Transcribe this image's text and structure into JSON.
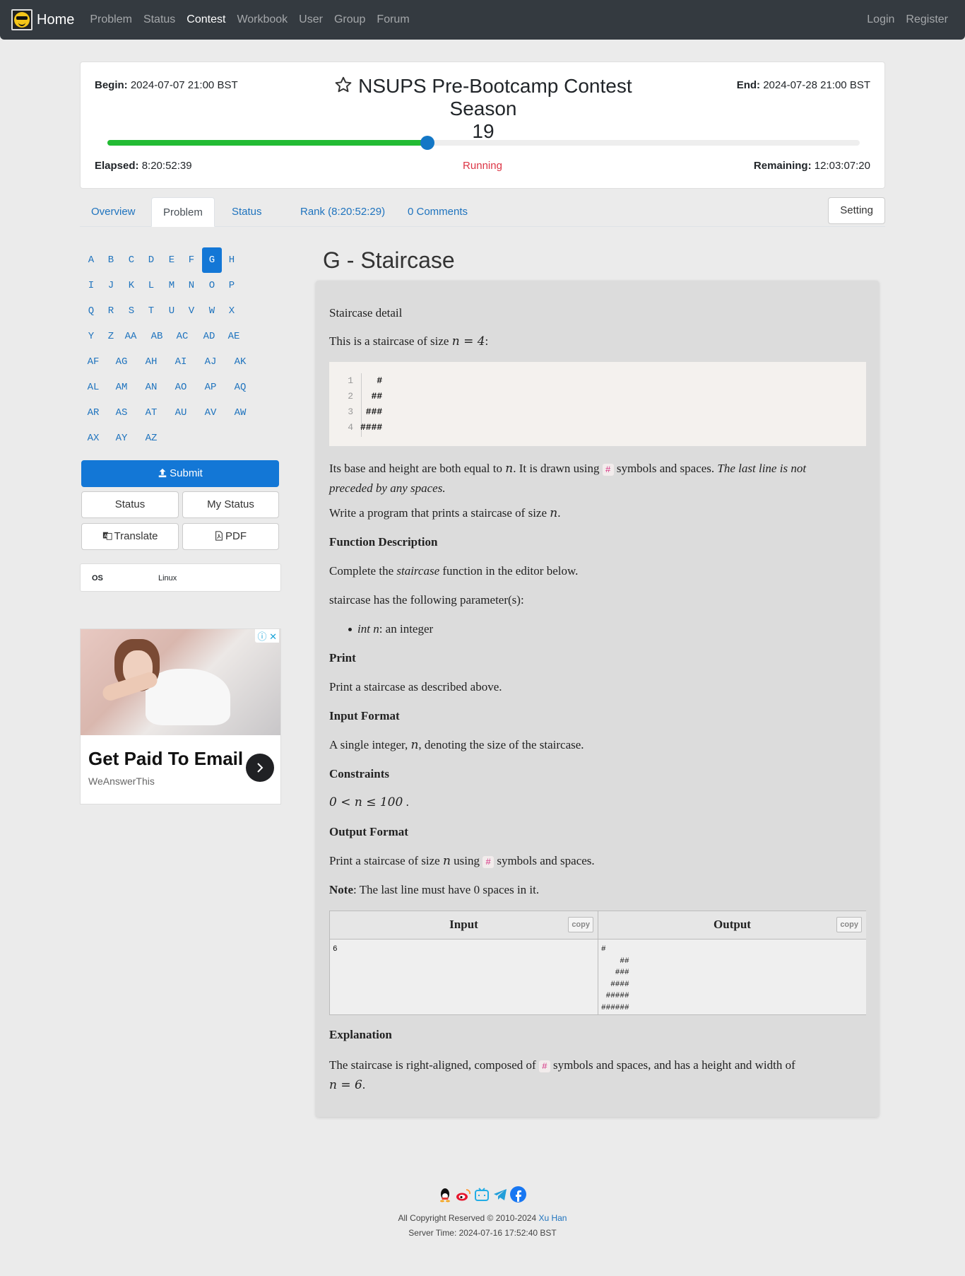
{
  "navbar": {
    "brand": "Home",
    "links": [
      "Problem",
      "Status",
      "Contest",
      "Workbook",
      "User",
      "Group",
      "Forum"
    ],
    "active": "Contest",
    "login": "Login",
    "register": "Register"
  },
  "contest": {
    "begin_label": "Begin:",
    "begin": "2024-07-07 21:00 BST",
    "end_label": "End:",
    "end": "2024-07-28 21:00 BST",
    "title_line1": "NSUPS Pre-Bootcamp Contest Season",
    "title_line2": "19",
    "progress": 0.425,
    "elapsed_label": "Elapsed:",
    "elapsed": "8:20:52:39",
    "status": "Running",
    "remaining_label": "Remaining:",
    "remaining": "12:03:07:20",
    "colors": {
      "progress": "#22bb33",
      "handle": "#1377c6",
      "status": "#dc3545"
    }
  },
  "tabs": {
    "overview": "Overview",
    "problem": "Problem",
    "status": "Status",
    "rank": "Rank (8:20:52:29)",
    "comments": "0 Comments",
    "setting": "Setting"
  },
  "letters": [
    "A",
    "B",
    "C",
    "D",
    "E",
    "F",
    "G",
    "H",
    "I",
    "J",
    "K",
    "L",
    "M",
    "N",
    "O",
    "P",
    "Q",
    "R",
    "S",
    "T",
    "U",
    "V",
    "W",
    "X",
    "Y",
    "Z",
    "AA",
    "AB",
    "AC",
    "AD",
    "AE",
    "AF",
    "AG",
    "AH",
    "AI",
    "AJ",
    "AK",
    "AL",
    "AM",
    "AN",
    "AO",
    "AP",
    "AQ",
    "AR",
    "AS",
    "AT",
    "AU",
    "AV",
    "AW",
    "AX",
    "AY",
    "AZ"
  ],
  "active_letter": "G",
  "actions": {
    "submit": "Submit",
    "status": "Status",
    "my_status": "My Status",
    "translate": "Translate",
    "pdf": "PDF"
  },
  "os": {
    "label": "OS",
    "value": "Linux"
  },
  "ad": {
    "title": "Get Paid To Email",
    "sub": "WeAnswerThis",
    "info": "ⓘ ✕"
  },
  "problem": {
    "title": "G - Staircase",
    "detail": "Staircase detail",
    "intro_a": "This is a staircase of size ",
    "intro_math": "n = 4",
    "intro_b": ":",
    "code_nums": [
      "1",
      "2",
      "3",
      "4"
    ],
    "code_lines": [
      "   #",
      "  ##",
      " ###",
      "####"
    ],
    "p1_a": "Its base and height are both equal to ",
    "p1_math": "n",
    "p1_b": ". It is drawn using ",
    "hash": "#",
    "p1_c": " symbols and spaces. ",
    "p1_italic1": "The last line is not",
    "p1_italic2": "preceded by any spaces.",
    "p2_a": "Write a program that prints a staircase of size ",
    "p2_math": "n",
    "p2_b": ".",
    "h_function": "Function Description",
    "p3_a": "Complete the ",
    "p3_italic": "staircase",
    "p3_b": " function in the editor below.",
    "p4": "staircase has the following parameter(s):",
    "li_italic": "int n",
    "li_rest": ": an integer",
    "h_print": "Print",
    "p5": "Print a staircase as described above.",
    "h_input": "Input Format",
    "p6_a": "A single integer, ",
    "p6_math": "n",
    "p6_b": ", denoting the size of the staircase.",
    "h_constraints": "Constraints",
    "constraint": "0 < n ≤ 100",
    "constraint_end": " .",
    "h_output": "Output Format",
    "p7_a": "Print a staircase of size ",
    "p7_math": "n",
    "p7_b": " using ",
    "p7_c": " symbols and spaces.",
    "note_label": "Note",
    "note_a": ": The last line must have ",
    "note_math": "0",
    "note_b": " spaces in it.",
    "io": {
      "input_label": "Input",
      "output_label": "Output",
      "copy": "copy",
      "input": "6",
      "output": "#\n    ##\n   ###\n  ####\n #####\n######"
    },
    "h_explanation": "Explanation",
    "p8_a": "The staircase is right-aligned, composed of ",
    "p8_b": " symbols and spaces, and has a height and width of",
    "p8_math": "n = 6",
    "p8_c": "."
  },
  "footer": {
    "icons": [
      "qq-icon",
      "weibo-icon",
      "bilibili-icon",
      "telegram-icon",
      "facebook-icon"
    ],
    "copyright": "All Copyright Reserved © 2010-2024 ",
    "author": "Xu Han",
    "server_time": "Server Time: 2024-07-16 17:52:40 BST"
  }
}
